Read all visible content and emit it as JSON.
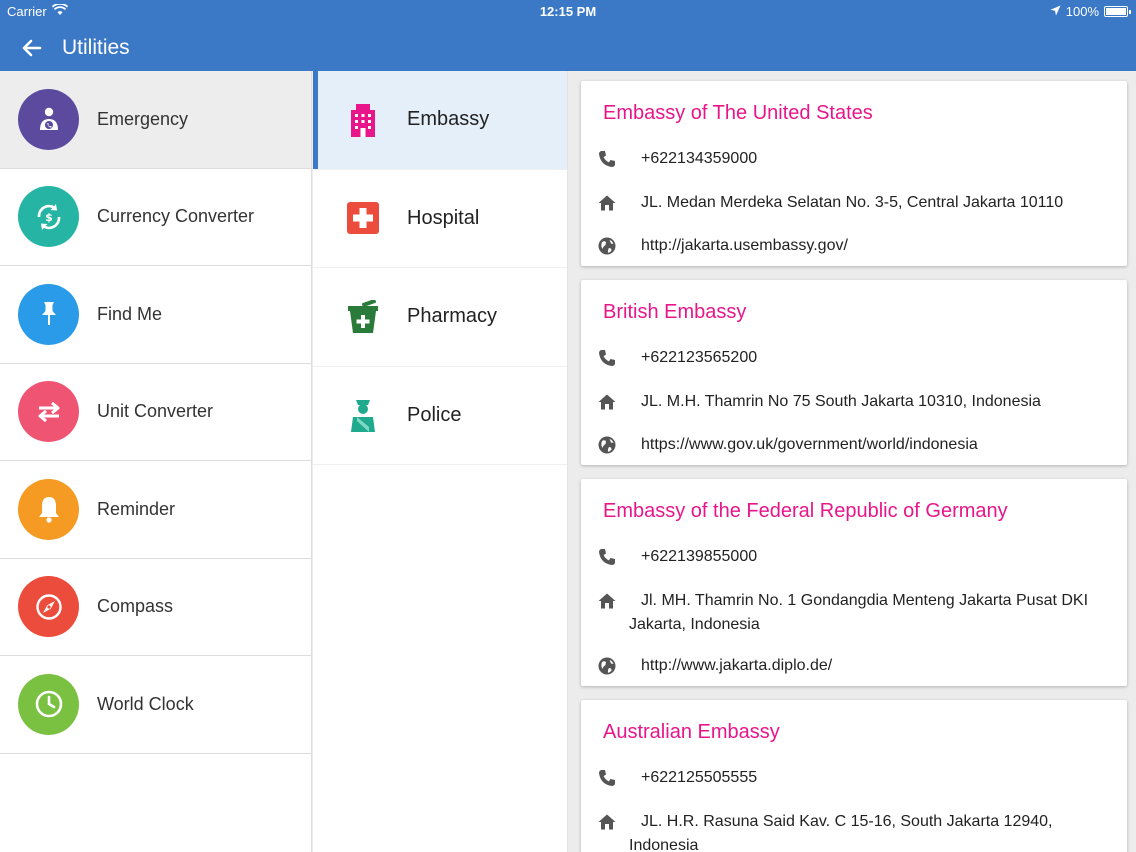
{
  "status": {
    "carrier": "Carrier",
    "time": "12:15 PM",
    "battery": "100%"
  },
  "appbar": {
    "title": "Utilities"
  },
  "sidebar": {
    "items": [
      {
        "label": "Emergency",
        "color": "#5b4a9e",
        "active": true
      },
      {
        "label": "Currency Converter",
        "color": "#26b5a4"
      },
      {
        "label": "Find Me",
        "color": "#2a9be8"
      },
      {
        "label": "Unit Converter",
        "color": "#ef5473"
      },
      {
        "label": "Reminder",
        "color": "#f59a23"
      },
      {
        "label": "Compass",
        "color": "#ec4c3c"
      },
      {
        "label": "World Clock",
        "color": "#7ac142"
      }
    ]
  },
  "categories": {
    "items": [
      {
        "label": "Embassy",
        "icon": "building-icon",
        "color": "#e8168a",
        "active": true
      },
      {
        "label": "Hospital",
        "icon": "medical-cross-icon",
        "color": "#ec4c3c"
      },
      {
        "label": "Pharmacy",
        "icon": "pharmacy-icon",
        "color": "#2a7a3a"
      },
      {
        "label": "Police",
        "icon": "police-officer-icon",
        "color": "#1fa98d"
      }
    ]
  },
  "embassies": [
    {
      "name": "Embassy of The United States",
      "phone": "+622134359000",
      "address": "JL. Medan Merdeka Selatan No. 3-5, Central Jakarta 10110",
      "website": "http://jakarta.usembassy.gov/"
    },
    {
      "name": "British Embassy",
      "phone": "+622123565200",
      "address": "JL. M.H. Thamrin No 75 South Jakarta 10310, Indonesia",
      "website": "https://www.gov.uk/government/world/indonesia"
    },
    {
      "name": "Embassy of the Federal Republic of Germany",
      "phone": "+622139855000",
      "address_line1": "Jl. MH. Thamrin No. 1  Gondangdia Menteng Jakarta Pusat DKI",
      "address_line2": "Jakarta, Indonesia",
      "website": "http://www.jakarta.diplo.de/"
    },
    {
      "name": "Australian Embassy",
      "phone": "+622125505555",
      "address_line1": "JL. H.R. Rasuna Said Kav. C 15-16, South Jakarta 12940,",
      "address_line2": "Indonesia"
    }
  ]
}
